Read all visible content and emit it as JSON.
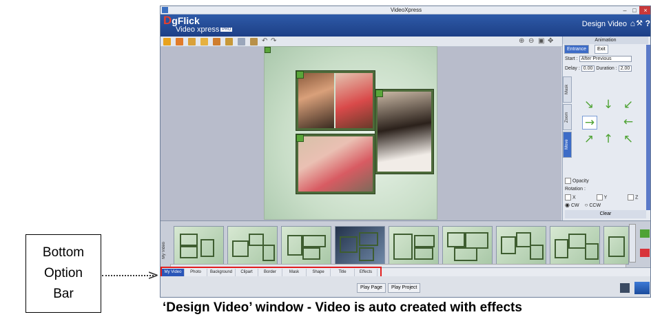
{
  "callout": {
    "label": "Bottom\nOption\nBar"
  },
  "caption": "‘Design Video’ window - Video is auto created with effects",
  "window": {
    "title": "VideoXpress",
    "controls": [
      "–",
      "□",
      "×"
    ]
  },
  "header": {
    "logo_d": "D",
    "logo_rest": "gFlick",
    "logo_sub": "Video xpress",
    "logo_badge": "PRO",
    "mode_title": "Design Video",
    "help": "?"
  },
  "panel": {
    "title": "Animation",
    "tabs": [
      "Entrance",
      "Exit"
    ],
    "start_label": "Start :",
    "start_value": "After Previous",
    "delay_label": "Delay :",
    "delay_value": "0.00",
    "duration_label": "Duration :",
    "duration_value": "2.00",
    "side_tabs": [
      "Mask",
      "Zoom",
      "Move"
    ],
    "opacity_label": "Opacity",
    "rotation_label": "Rotation :",
    "axis_x": "X",
    "axis_y": "Y",
    "axis_z": "Z",
    "cw_label": "CW",
    "ccw_label": "CCW",
    "clear_label": "Clear"
  },
  "filmstrip": {
    "label": "My Video"
  },
  "bottom_tabs": [
    {
      "label": "My Video",
      "active": true
    },
    {
      "label": "Photo"
    },
    {
      "label": "Background"
    },
    {
      "label": "Clipart"
    },
    {
      "label": "Border"
    },
    {
      "label": "Mask"
    },
    {
      "label": "Shape"
    },
    {
      "label": "Title"
    },
    {
      "label": "Effects"
    }
  ],
  "play": {
    "page": "Play Page",
    "project": "Play Project"
  },
  "colors": {
    "highlight": "#e21d1d",
    "accent": "#2a56b8",
    "arrow": "#4fa334"
  }
}
